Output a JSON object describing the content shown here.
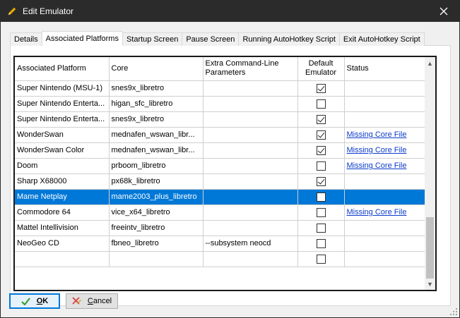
{
  "window": {
    "title": "Edit Emulator",
    "icon": "pencil-icon"
  },
  "tabs": [
    {
      "label": "Details",
      "active": false
    },
    {
      "label": "Associated Platforms",
      "active": true
    },
    {
      "label": "Startup Screen",
      "active": false
    },
    {
      "label": "Pause Screen",
      "active": false
    },
    {
      "label": "Running AutoHotkey Script",
      "active": false
    },
    {
      "label": "Exit AutoHotkey Script",
      "active": false
    }
  ],
  "grid": {
    "columns": {
      "platform": "Associated Platform",
      "core": "Core",
      "args": "Extra Command-Line Parameters",
      "default": "Default Emulator",
      "status": "Status"
    },
    "rows": [
      {
        "platform": "Super Nintendo (MSU-1)",
        "core": "snes9x_libretro",
        "args": "",
        "default": true,
        "status": ""
      },
      {
        "platform": "Super Nintendo Enterta...",
        "core": "higan_sfc_libretro",
        "args": "",
        "default": false,
        "status": ""
      },
      {
        "platform": "Super Nintendo Enterta...",
        "core": "snes9x_libretro",
        "args": "",
        "default": true,
        "status": ""
      },
      {
        "platform": "WonderSwan",
        "core": "mednafen_wswan_libr...",
        "args": "",
        "default": true,
        "status": "Missing Core File"
      },
      {
        "platform": "WonderSwan Color",
        "core": "mednafen_wswan_libr...",
        "args": "",
        "default": true,
        "status": "Missing Core File"
      },
      {
        "platform": "Doom",
        "core": "prboom_libretro",
        "args": "",
        "default": false,
        "status": "Missing Core File"
      },
      {
        "platform": "Sharp X68000",
        "core": "px68k_libretro",
        "args": "",
        "default": true,
        "status": ""
      },
      {
        "platform": "Mame Netplay",
        "core": "mame2003_plus_libretro",
        "args": "",
        "default": false,
        "status": "",
        "selected": true
      },
      {
        "platform": "Commodore 64",
        "core": "vice_x64_libretro",
        "args": "",
        "default": false,
        "status": "Missing Core File"
      },
      {
        "platform": "Mattel Intellivision",
        "core": "freeintv_libretro",
        "args": "",
        "default": false,
        "status": ""
      },
      {
        "platform": "NeoGeo CD",
        "core": "fbneo_libretro",
        "args": "--subsystem neocd",
        "default": false,
        "status": ""
      },
      {
        "platform": "",
        "core": "",
        "args": "",
        "default": false,
        "status": ""
      }
    ]
  },
  "buttons": {
    "ok": {
      "mnemonic": "O",
      "rest": "K",
      "icon": "checkmark-icon"
    },
    "cancel": {
      "mnemonic": "C",
      "rest": "ancel",
      "icon": "pencil-x-icon"
    }
  },
  "colors": {
    "selection": "#0078d7",
    "link": "#0b3bc9",
    "titlebar": "#2b2b2b"
  }
}
